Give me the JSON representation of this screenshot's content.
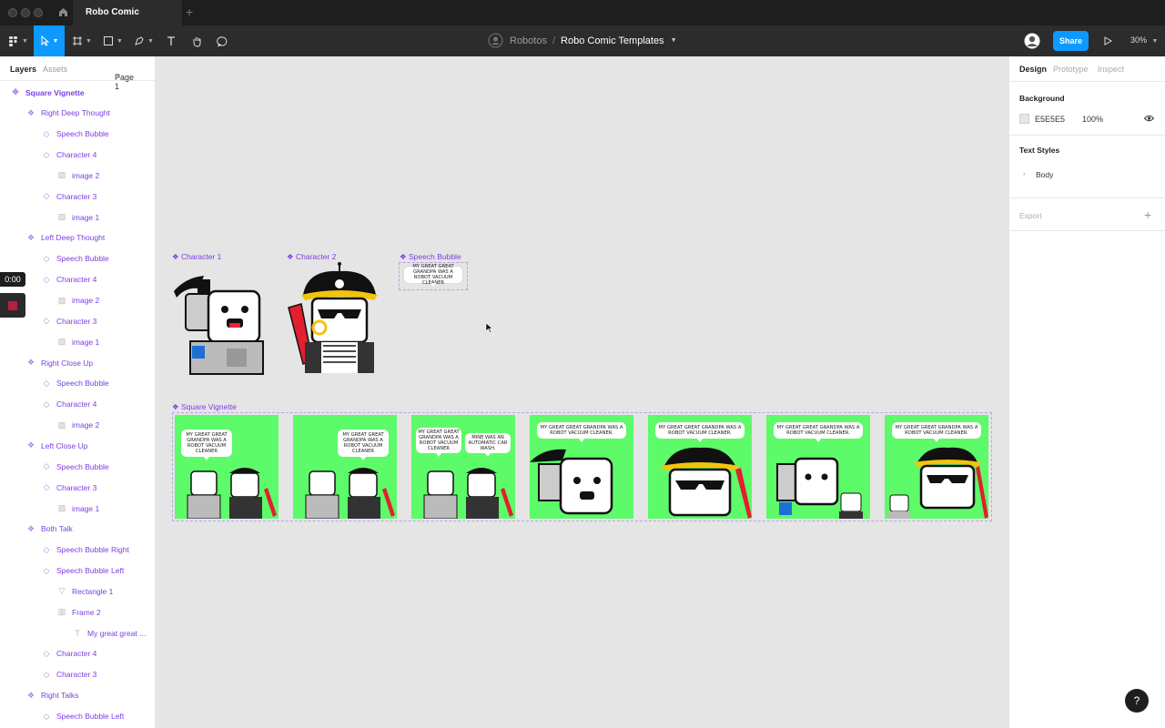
{
  "tab": {
    "title": "Robo Comic Templates"
  },
  "breadcrumb": {
    "team": "Robotos",
    "separator": "/",
    "file": "Robo Comic Templates"
  },
  "toolbar": {
    "share_label": "Share",
    "zoom": "30%"
  },
  "left_panel": {
    "tabs": {
      "layers": "Layers",
      "assets": "Assets",
      "page": "Page 1"
    },
    "layers": [
      {
        "label": "Square Vignette",
        "icon": "frame-component-icon",
        "depth": 0
      },
      {
        "label": "Right Deep Thought",
        "icon": "component-icon",
        "depth": 1
      },
      {
        "label": "Speech Bubble",
        "icon": "instance-icon",
        "depth": 2
      },
      {
        "label": "Character 4",
        "icon": "instance-icon",
        "depth": 2
      },
      {
        "label": "image 2",
        "icon": "image-icon",
        "depth": 3
      },
      {
        "label": "Character 3",
        "icon": "instance-icon",
        "depth": 2
      },
      {
        "label": "image 1",
        "icon": "image-icon",
        "depth": 3
      },
      {
        "label": "Left Deep Thought",
        "icon": "component-icon",
        "depth": 1
      },
      {
        "label": "Speech Bubble",
        "icon": "instance-icon",
        "depth": 2
      },
      {
        "label": "Character 4",
        "icon": "instance-icon",
        "depth": 2
      },
      {
        "label": "image 2",
        "icon": "image-icon",
        "depth": 3
      },
      {
        "label": "Character 3",
        "icon": "instance-icon",
        "depth": 2
      },
      {
        "label": "image 1",
        "icon": "image-icon",
        "depth": 3
      },
      {
        "label": "Right Close Up",
        "icon": "component-icon",
        "depth": 1
      },
      {
        "label": "Speech Bubble",
        "icon": "instance-icon",
        "depth": 2
      },
      {
        "label": "Character 4",
        "icon": "instance-icon",
        "depth": 2
      },
      {
        "label": "image 2",
        "icon": "image-icon",
        "depth": 3
      },
      {
        "label": "Left Close Up",
        "icon": "component-icon",
        "depth": 1
      },
      {
        "label": "Speech Bubble",
        "icon": "instance-icon",
        "depth": 2
      },
      {
        "label": "Character 3",
        "icon": "instance-icon",
        "depth": 2
      },
      {
        "label": "image 1",
        "icon": "image-icon",
        "depth": 3
      },
      {
        "label": "Both Talk",
        "icon": "component-icon",
        "depth": 1
      },
      {
        "label": "Speech Bubble Right",
        "icon": "instance-icon",
        "depth": 2
      },
      {
        "label": "Speech Bubble Left",
        "icon": "instance-icon",
        "depth": 2
      },
      {
        "label": "Rectangle 1",
        "icon": "vector-icon",
        "depth": 3
      },
      {
        "label": "Frame 2",
        "icon": "frame-icon",
        "depth": 3
      },
      {
        "label": "My great great ...",
        "icon": "text-icon",
        "depth": 4
      },
      {
        "label": "Character 4",
        "icon": "instance-icon",
        "depth": 2
      },
      {
        "label": "Character 3",
        "icon": "instance-icon",
        "depth": 2
      },
      {
        "label": "Right Talks",
        "icon": "component-icon",
        "depth": 1
      },
      {
        "label": "Speech Bubble Left",
        "icon": "instance-icon",
        "depth": 2
      }
    ]
  },
  "recorder": {
    "time": "0:00"
  },
  "right_panel": {
    "tabs": {
      "design": "Design",
      "prototype": "Prototype",
      "inspect": "Inspect"
    },
    "background": {
      "title": "Background",
      "hex": "E5E5E5",
      "opacity": "100%"
    },
    "text_styles": {
      "title": "Text Styles",
      "style": "Body"
    },
    "export": {
      "title": "Export",
      "add": "+"
    }
  },
  "canvas": {
    "labels": {
      "character1": "Character 1",
      "character2": "Character 2",
      "speech_bubble": "Speech Bubble",
      "square_vignette": "Square Vignette"
    },
    "bubble_text": "MY GREAT GREAT GRANDPA WAS A ROBOT VACUUM CLEANER",
    "bubble_text_reply": "MINE WAS AN AUTOMATIC CAR WASH.",
    "bubble_text_wide": "MY GREAT GREAT GRANDPA WAS A ROBOT VACUUM CLEANER."
  },
  "colors": {
    "accent": "#0d99ff",
    "component": "#7b3fe4",
    "panel_green": "#5dfa69",
    "canvas": "#e5e5e5"
  }
}
